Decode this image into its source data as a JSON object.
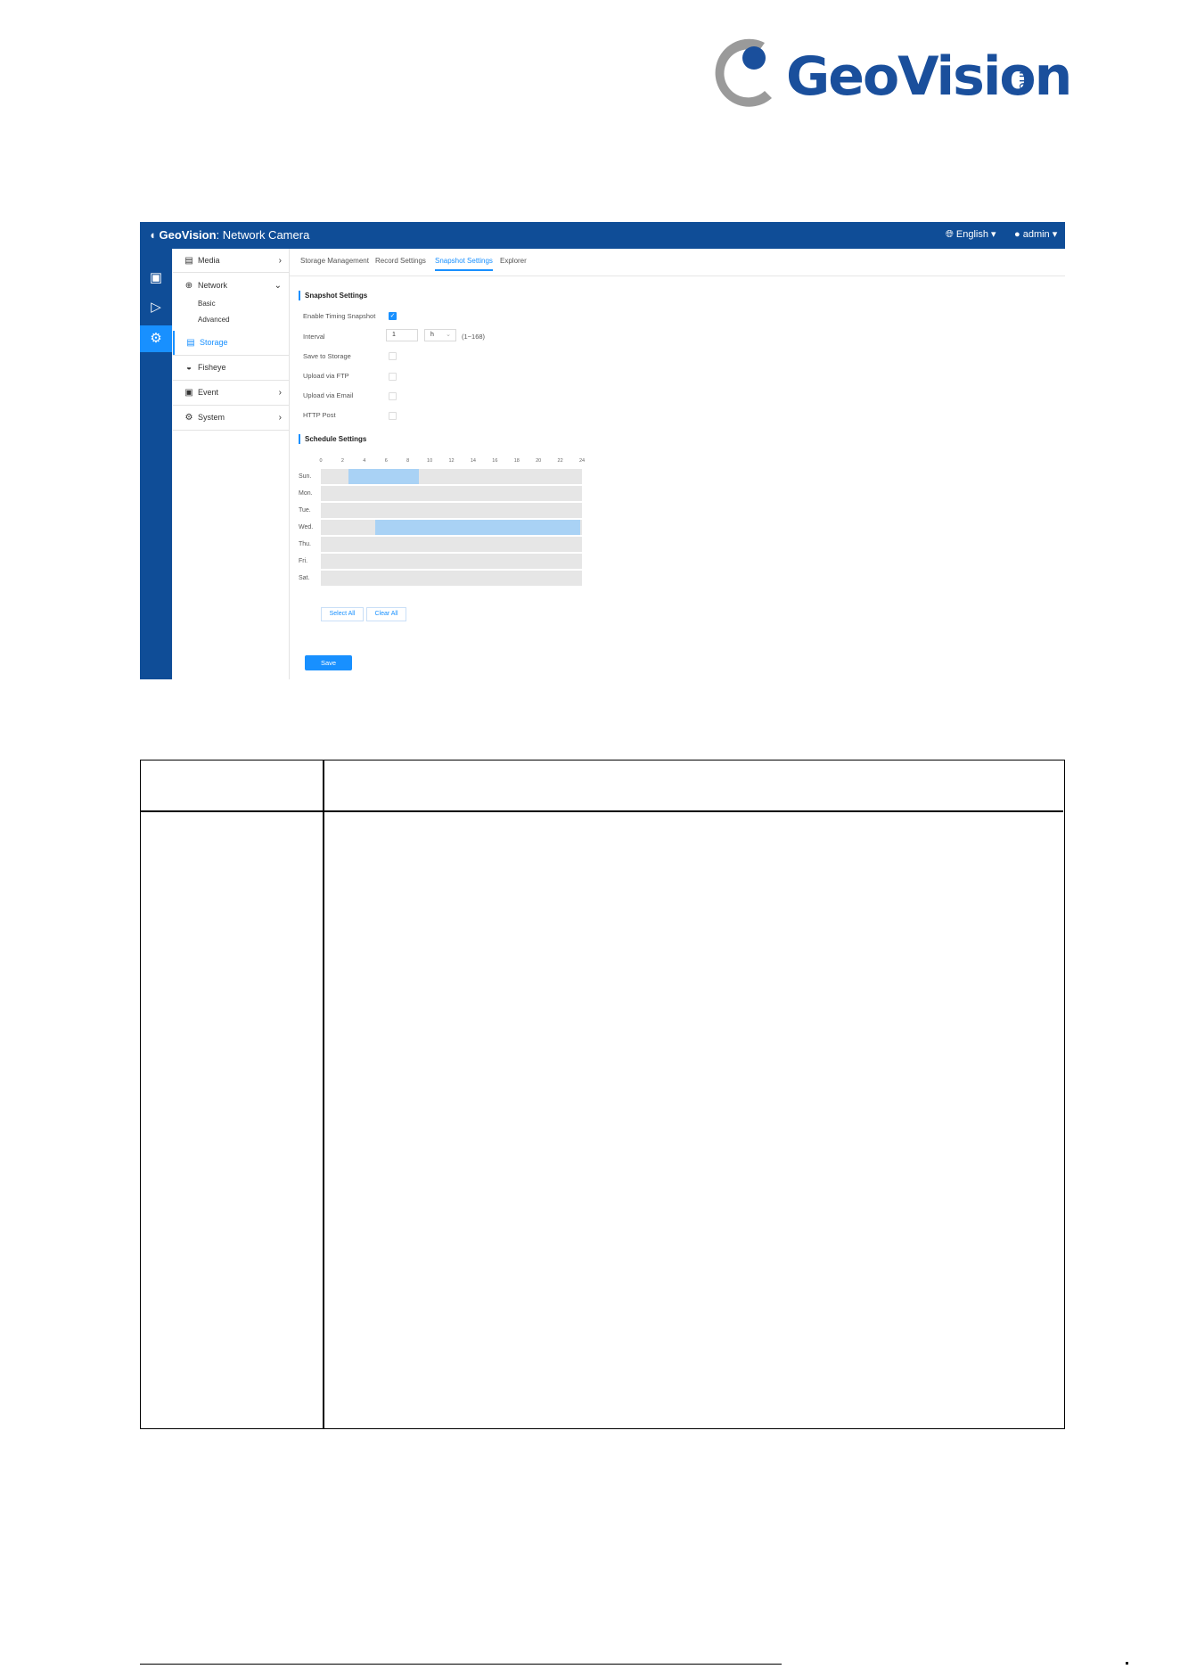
{
  "logo": {
    "text": "GeoVision",
    "suffix": "inc"
  },
  "app": {
    "brand_name": "GeoVision",
    "brand_title": ": Network Camera",
    "language": "English",
    "user": "admin",
    "nav": {
      "media": "Media",
      "network": "Network",
      "network_basic": "Basic",
      "network_advanced": "Advanced",
      "storage": "Storage",
      "fisheye": "Fisheye",
      "event": "Event",
      "system": "System"
    },
    "tabs": [
      "Storage Management",
      "Record Settings",
      "Snapshot Settings",
      "Explorer"
    ],
    "snapshot": {
      "section_title": "Snapshot Settings",
      "enable_label": "Enable Timing Snapshot",
      "enable_checked": true,
      "interval_label": "Interval",
      "interval_value": "1",
      "interval_unit": "h",
      "interval_range": "(1~168)",
      "save_storage_label": "Save to Storage",
      "ftp_label": "Upload via FTP",
      "email_label": "Upload via Email",
      "http_label": "HTTP Post"
    },
    "schedule": {
      "section_title": "Schedule Settings",
      "hours": [
        "0",
        "2",
        "4",
        "6",
        "8",
        "10",
        "12",
        "14",
        "16",
        "18",
        "20",
        "22",
        "24"
      ],
      "days": [
        "Sun.",
        "Mon.",
        "Tue.",
        "Wed.",
        "Thu.",
        "Fri.",
        "Sat."
      ],
      "ranges": [
        {
          "day": "Sun.",
          "start": 2.5,
          "end": 9
        },
        {
          "day": "Wed.",
          "start": 5,
          "end": 23.8
        }
      ],
      "select_all": "Select All",
      "clear_all": "Clear All"
    },
    "save_label": "Save"
  },
  "colors": {
    "navy": "#0f4d97",
    "accent": "#1890ff",
    "fill": "#a9d2f5"
  }
}
